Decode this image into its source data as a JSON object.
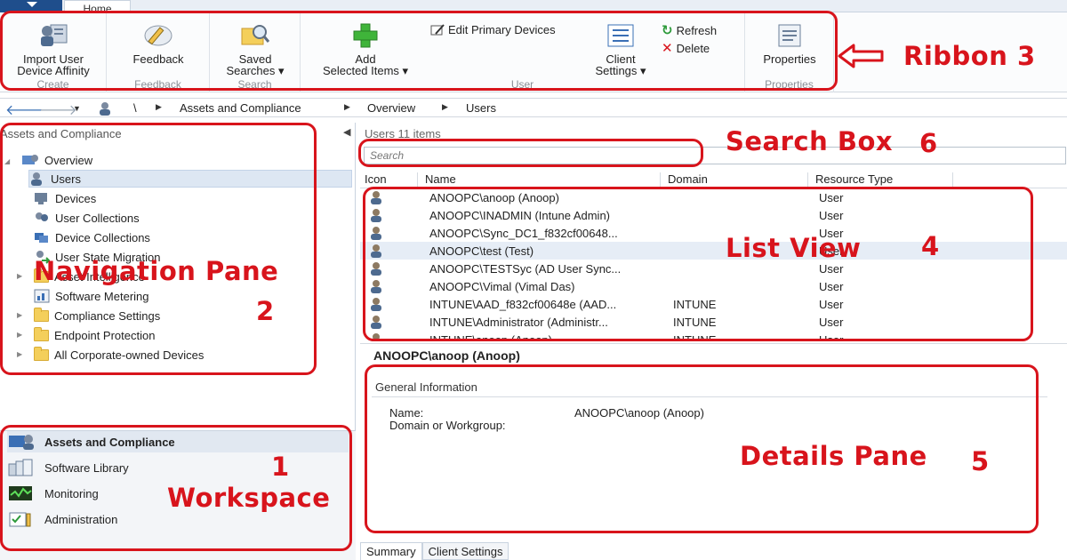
{
  "tabs": {
    "home": "Home"
  },
  "ribbon": {
    "groups": {
      "create": "Create",
      "feedback": "Feedback",
      "search": "Search",
      "user": "User",
      "properties": "Properties"
    },
    "buttons": {
      "import_line1": "Import User",
      "import_line2": "Device Affinity",
      "feedback": "Feedback",
      "saved_line1": "Saved",
      "saved_line2": "Searches ▾",
      "add_line1": "Add",
      "add_line2": "Selected Items ▾",
      "edit_primary": "Edit Primary Devices",
      "client_line1": "Client",
      "client_line2": "Settings ▾",
      "refresh": "Refresh",
      "delete": "Delete",
      "properties": "Properties"
    }
  },
  "breadcrumb": [
    "\\",
    "Assets and Compliance",
    "Overview",
    "Users"
  ],
  "nav": {
    "title": "Assets and Compliance",
    "overview": "Overview",
    "items": [
      "Users",
      "Devices",
      "User Collections",
      "Device Collections",
      "User State Migration",
      "Asset Intelligence",
      "Software Metering",
      "Compliance Settings",
      "Endpoint Protection",
      "All Corporate-owned Devices"
    ]
  },
  "workspaces": [
    "Assets and Compliance",
    "Software Library",
    "Monitoring",
    "Administration"
  ],
  "list": {
    "header": "Users 11 items",
    "search_placeholder": "Search",
    "columns": [
      "Icon",
      "Name",
      "Domain",
      "Resource Type"
    ],
    "rows": [
      {
        "name": "ANOOPC\\anoop (Anoop)",
        "domain": "",
        "type": "User"
      },
      {
        "name": "ANOOPC\\INADMIN (Intune Admin)",
        "domain": "",
        "type": "User"
      },
      {
        "name": "ANOOPC\\Sync_DC1_f832cf00648...",
        "domain": "",
        "type": "User"
      },
      {
        "name": "ANOOPC\\test (Test)",
        "domain": "",
        "type": "User"
      },
      {
        "name": "ANOOPC\\TESTSyc (AD User Sync...",
        "domain": "",
        "type": "User"
      },
      {
        "name": "ANOOPC\\Vimal (Vimal Das)",
        "domain": "",
        "type": "User"
      },
      {
        "name": "INTUNE\\AAD_f832cf00648e (AAD...",
        "domain": "INTUNE",
        "type": "User"
      },
      {
        "name": "INTUNE\\Administrator (Administr...",
        "domain": "INTUNE",
        "type": "User"
      },
      {
        "name": "INTUNE\\anoop (Anoop)",
        "domain": "INTUNE",
        "type": "User"
      }
    ]
  },
  "details": {
    "title": "ANOOPC\\anoop (Anoop)",
    "section": "General Information",
    "name_label": "Name:",
    "name_value": "ANOOPC\\anoop (Anoop)",
    "domain_label": "Domain or Workgroup:"
  },
  "bottom_tabs": [
    "Summary",
    "Client Settings"
  ],
  "annotations": {
    "ribbon": "Ribbon 3",
    "search_box": "Search Box",
    "search_num": "6",
    "list_view": "List View",
    "list_num": "4",
    "nav_pane": "Navigation Pane",
    "nav_num": "2",
    "workspace_num": "1",
    "workspace": "Workspace",
    "details_pane": "Details Pane",
    "details_num": "5"
  },
  "colors": {
    "annotation_red": "#d8141c",
    "app_blue": "#1f4e8c"
  }
}
